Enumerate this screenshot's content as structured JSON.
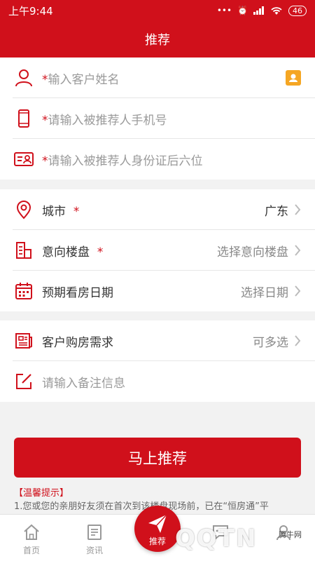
{
  "status_bar": {
    "time": "上午9:44",
    "battery": "46"
  },
  "header": {
    "title": "推荐"
  },
  "client_section": {
    "name_placeholder": "输入客户姓名",
    "phone_placeholder": "请输入被推荐人手机号",
    "id_placeholder": "请输入被推荐人身份证后六位",
    "required_mark": "*"
  },
  "property_section": {
    "city_label": "城市",
    "city_value": "广东",
    "estate_label": "意向楼盘",
    "estate_value": "选择意向楼盘",
    "date_label": "预期看房日期",
    "date_value": "选择日期",
    "required_mark": "*"
  },
  "needs_section": {
    "needs_label": "客户购房需求",
    "needs_value": "可多选",
    "remark_placeholder": "请输入备注信息"
  },
  "submit": {
    "label": "马上推荐"
  },
  "tips": {
    "title": "【温馨提示】",
    "text": "1.您或您的亲朋好友须在首次到该楼盘现场前，已在“恒房通”平"
  },
  "tabbar": {
    "home": "首页",
    "news": "资讯",
    "recommend": "推荐",
    "messages": "",
    "mine": ""
  },
  "watermark": {
    "brand": "QQTN",
    "small": "腾牛网"
  },
  "colors": {
    "brand": "#d0101b",
    "accent": "#f5a623"
  }
}
